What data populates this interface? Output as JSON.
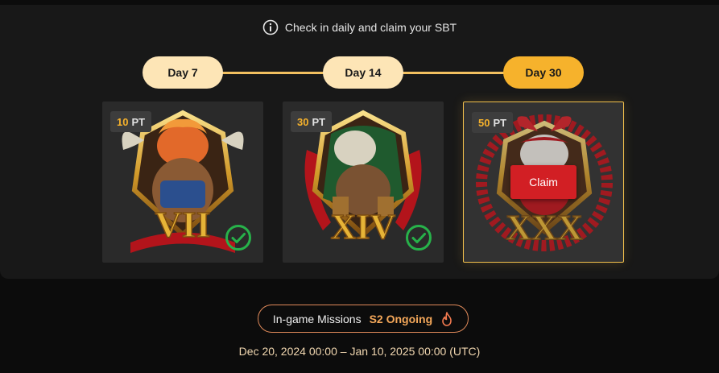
{
  "header": {
    "info_icon": "info-icon",
    "text": "Check in daily and claim your SBT"
  },
  "timeline": {
    "days": [
      {
        "label": "Day 7",
        "state": "reached"
      },
      {
        "label": "Day 14",
        "state": "reached"
      },
      {
        "label": "Day 30",
        "state": "current"
      }
    ],
    "colors": {
      "reached": "#fde5b6",
      "current": "#f6b22c",
      "track": "#f2c060"
    }
  },
  "rewards": [
    {
      "points": "10",
      "unit": "PT",
      "numeral": "VII",
      "status": "claimed",
      "status_icon": "check-circle-icon"
    },
    {
      "points": "30",
      "unit": "PT",
      "numeral": "XIV",
      "status": "claimed",
      "status_icon": "check-circle-icon"
    },
    {
      "points": "50",
      "unit": "PT",
      "numeral": "XXX",
      "status": "claimable",
      "button_label": "Claim"
    }
  ],
  "missions": {
    "label": "In-game Missions",
    "status": "S2 Ongoing",
    "status_icon": "fire-icon"
  },
  "period": "Dec 20, 2024 00:00 – Jan 10, 2025 00:00 (UTC)",
  "colors": {
    "accent": "#f6b22c",
    "claim_button": "#d21f24",
    "check": "#27b24a",
    "background": "#0c0c0c",
    "panel": "#181818"
  }
}
